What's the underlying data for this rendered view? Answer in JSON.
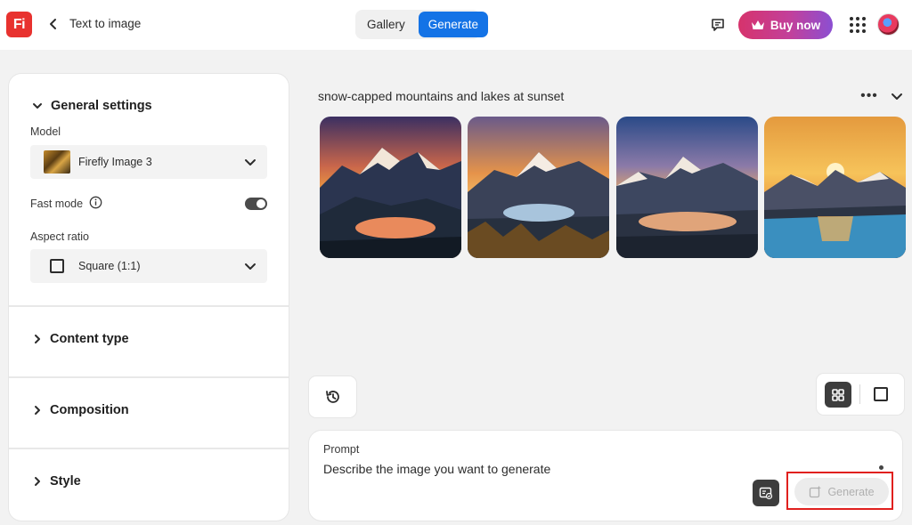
{
  "header": {
    "logo_text": "Fi",
    "page_title": "Text to image",
    "tabs": [
      {
        "label": "Gallery",
        "active": false
      },
      {
        "label": "Generate",
        "active": true
      }
    ],
    "buy_label": "Buy now",
    "accent_color": "#1473e6",
    "logo_color": "#e8322f"
  },
  "sidebar": {
    "general": {
      "title": "General settings",
      "model_label": "Model",
      "model_value": "Firefly Image 3",
      "fast_mode_label": "Fast mode",
      "fast_mode_on": true,
      "aspect_label": "Aspect ratio",
      "aspect_value": "Square (1:1)"
    },
    "content_type": "Content type",
    "composition": "Composition",
    "style": "Style"
  },
  "main": {
    "prompt_title": "snow-capped mountains and lakes at sunset",
    "prompt_label": "Prompt",
    "prompt_placeholder": "Describe the image you want to generate",
    "generate_label": "Generate"
  }
}
